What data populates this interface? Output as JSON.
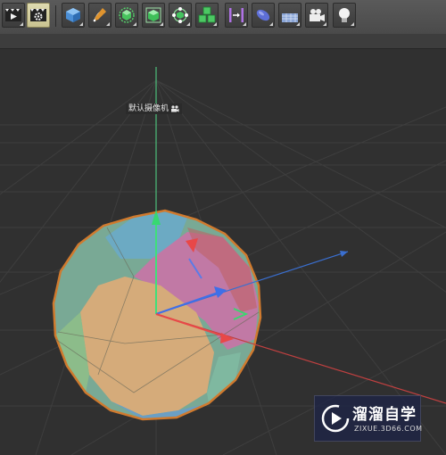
{
  "toolbar": {
    "buttons": [
      {
        "name": "render-view-icon"
      },
      {
        "name": "render-settings-icon"
      },
      {
        "name": "cube-object-icon"
      },
      {
        "name": "pen-spline-icon"
      },
      {
        "name": "subdivision-surface-icon"
      },
      {
        "name": "extrude-generator-icon"
      },
      {
        "name": "mograph-cloner-icon"
      },
      {
        "name": "array-cubes-icon"
      },
      {
        "name": "deformer-bend-icon"
      },
      {
        "name": "scene-object-icon"
      },
      {
        "name": "floor-plane-icon"
      },
      {
        "name": "camera-icon"
      },
      {
        "name": "light-icon"
      }
    ]
  },
  "viewport": {
    "camera_label": "默认摄像机"
  },
  "watermark": {
    "title": "溜溜自学",
    "subtitle": "ZIXUE.3D66.COM"
  },
  "colors": {
    "toolbar_bg": "#4f4f4f",
    "viewport_bg": "#2e2e2e",
    "grid": "#3e3e3e",
    "axis_x": "#e04a4a",
    "axis_y": "#52d98a",
    "axis_z": "#3f7fe0",
    "sphere_outline": "#d07a2e"
  }
}
